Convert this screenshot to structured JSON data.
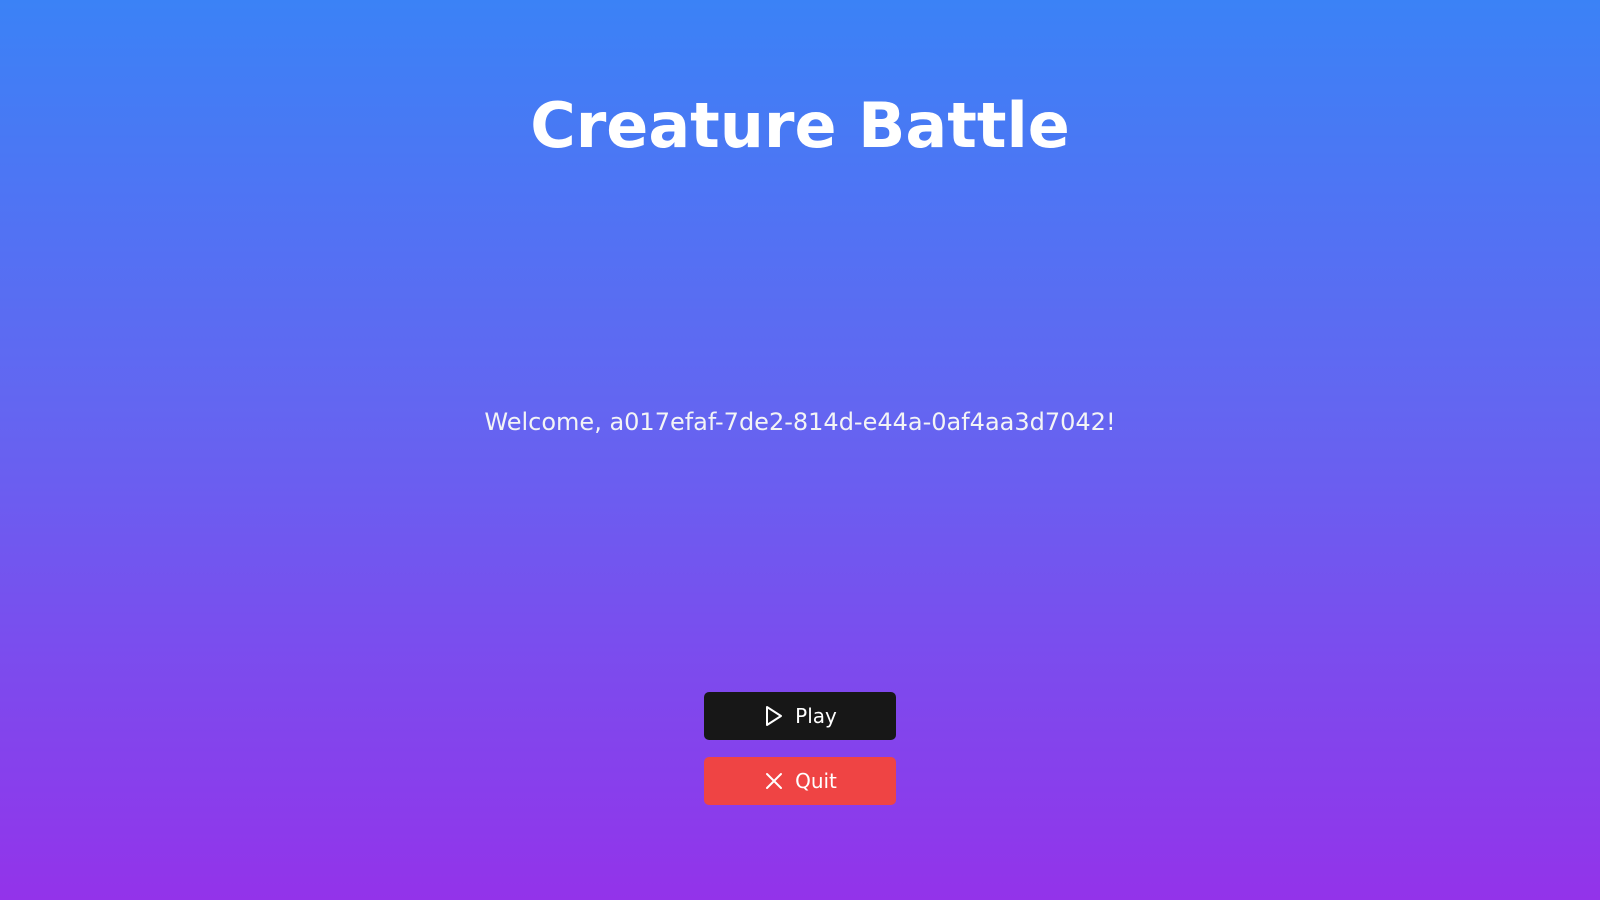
{
  "title": "Creature Battle",
  "welcome_text": "Welcome, a017efaf-7de2-814d-e44a-0af4aa3d7042!",
  "buttons": {
    "play": {
      "label": "Play",
      "icon": "play-icon",
      "color": "#171717"
    },
    "quit": {
      "label": "Quit",
      "icon": "close-icon",
      "color": "#ef4444"
    }
  },
  "theme": {
    "gradient_top": "#3b82f6",
    "gradient_bottom": "#9333ea",
    "text_color": "#ffffff"
  }
}
